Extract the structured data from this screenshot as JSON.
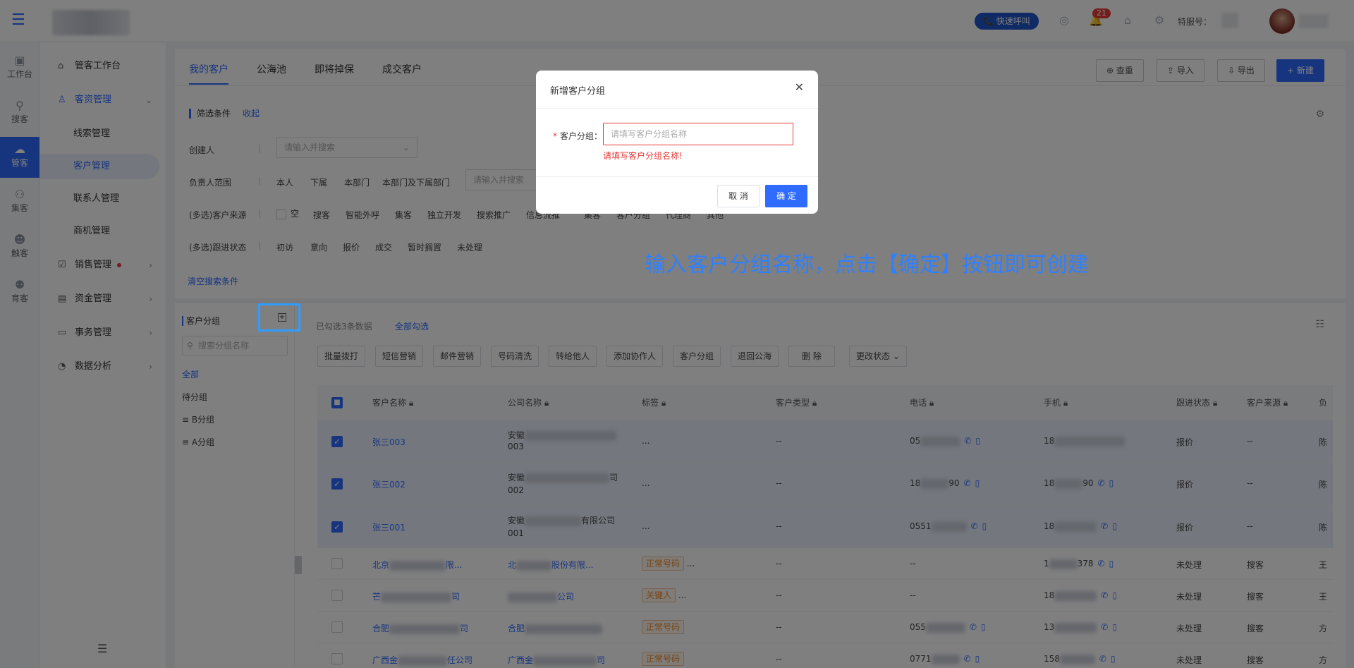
{
  "topbar": {
    "quick_call": "快速呼叫",
    "notif_count": "21",
    "special_label": "特服号："
  },
  "rail": [
    "工作台",
    "搜客",
    "管客",
    "集客",
    "触客",
    "育客"
  ],
  "sidebar": {
    "workbench": "管客工作台",
    "customer_mgmt": "客资管理",
    "sub": [
      "线索管理",
      "客户管理",
      "联系人管理",
      "商机管理"
    ],
    "sales": "销售管理",
    "funds": "资金管理",
    "affairs": "事务管理",
    "analysis": "数据分析"
  },
  "tabs": [
    "我的客户",
    "公海池",
    "即将掉保",
    "成交客户"
  ],
  "actions": {
    "check": "查重",
    "import": "导入",
    "export": "导出",
    "new": "+ 新建"
  },
  "filter": {
    "title": "筛选条件",
    "collapse": "收起",
    "creator_label": "创建人",
    "creator_placeholder": "请输入并搜索",
    "owner_label": "负责人范围",
    "owner_opts": [
      "本人",
      "下属",
      "本部门",
      "本部门及下属部门"
    ],
    "owner_placeholder": "请输入并搜索",
    "source_label": "(多选)客户来源",
    "source_opts": [
      "空",
      "搜客",
      "智能外呼",
      "集客",
      "独立开发",
      "搜索推广",
      "信息流推",
      "集客",
      "客户分组",
      "代理商",
      "其他"
    ],
    "status_label": "(多选)跟进状态",
    "status_opts": [
      "初访",
      "意向",
      "报价",
      "成交",
      "暂时搁置",
      "未处理"
    ],
    "clear": "清空搜索条件"
  },
  "groups": {
    "title": "客户分组",
    "search_placeholder": "搜索分组名称",
    "items": [
      "全部",
      "待分组",
      "B分组",
      "A分组"
    ]
  },
  "selection": {
    "info": "已勾选3条数据",
    "select_all": "全部勾选"
  },
  "ops": [
    "批量拨打",
    "短信营销",
    "邮件营销",
    "号码清洗",
    "转给他人",
    "添加协作人",
    "客户分组",
    "退回公海",
    "删 除",
    "更改状态"
  ],
  "table": {
    "headers": [
      "客户名称",
      "公司名称",
      "标签",
      "客户类型",
      "电话",
      "手机",
      "跟进状态",
      "客户来源",
      "负"
    ],
    "rows": [
      {
        "name": "张三003",
        "company": "安徽",
        "company2": "003",
        "tag": "...",
        "type": "--",
        "phone": "05",
        "mobile": "18",
        "status": "报价",
        "source": "--",
        "owner": "陈"
      },
      {
        "name": "张三002",
        "company": "安徽",
        "company2": "002",
        "tag": "...",
        "type": "--",
        "phone": "18",
        "phone_end": "90",
        "mobile": "18",
        "mobile_end": "90",
        "status": "报价",
        "source": "--",
        "owner": "陈"
      },
      {
        "name": "张三001",
        "company": "安徽",
        "company_end": "有限公司",
        "company2": "001",
        "tag": "...",
        "type": "--",
        "phone": "0551",
        "mobile": "18",
        "status": "报价",
        "source": "--",
        "owner": "陈"
      },
      {
        "name": "北京",
        "name_end": "限...",
        "company": "北",
        "company_end": "股份有限...",
        "tag": "正常号码",
        "type": "--",
        "phone": "--",
        "mobile": "1",
        "mobile_end": "378",
        "status": "未处理",
        "source": "搜客",
        "owner": "王"
      },
      {
        "name": "芒",
        "name_end": "司",
        "company": "",
        "company_end": "公司",
        "tag": "关键人",
        "type": "--",
        "phone": "--",
        "mobile": "18",
        "status": "未处理",
        "source": "搜客",
        "owner": "王"
      },
      {
        "name": "合肥",
        "name_end": "司",
        "company": "合肥",
        "company_end": "",
        "tag": "正常号码",
        "type": "--",
        "phone": "055",
        "mobile": "13",
        "status": "未处理",
        "source": "搜客",
        "owner": "方"
      },
      {
        "name": "广西金",
        "name_end": "任公司",
        "company": "广西金",
        "company_end": "司",
        "tag": "正常号码",
        "type": "--",
        "phone": "0771",
        "mobile": "158",
        "status": "未处理",
        "source": "搜客",
        "owner": "方"
      }
    ]
  },
  "modal": {
    "title": "新增客户分组",
    "label": "客户分组：",
    "placeholder": "请填写客户分组名称",
    "error": "请填写客户分组名称!",
    "cancel": "取 消",
    "ok": "确 定"
  },
  "hint": "输入客户分组名称，点击【确定】按钮即可创建"
}
